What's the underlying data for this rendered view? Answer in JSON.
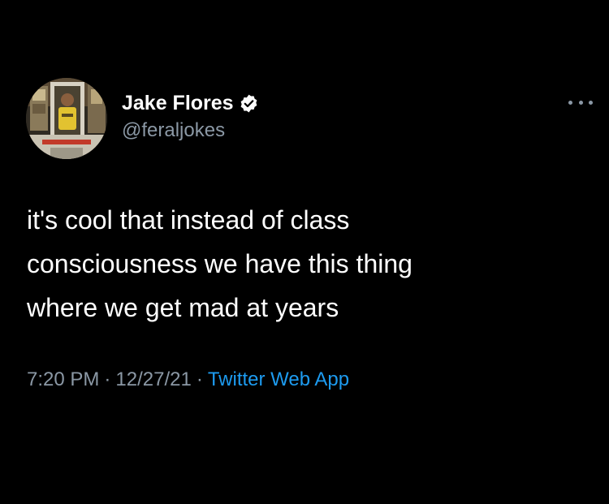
{
  "author": {
    "display_name": "Jake Flores",
    "handle": "@feraljokes",
    "verified": true
  },
  "tweet": {
    "lines": [
      "it's cool that instead of class",
      "consciousness we have this thing",
      "where we get mad at years"
    ]
  },
  "meta": {
    "time": "7:20 PM",
    "separator": "·",
    "date": "12/27/21",
    "source": "Twitter Web App"
  },
  "colors": {
    "background": "#000000",
    "text": "#ffffff",
    "muted": "#8b98a5",
    "link": "#1d9bf0"
  },
  "icons": {
    "verified": "verified-badge-icon",
    "more": "more-options-icon"
  }
}
